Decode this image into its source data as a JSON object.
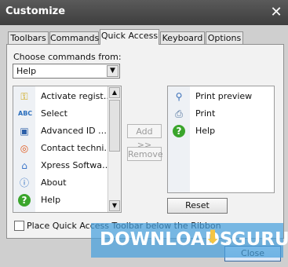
{
  "window": {
    "title": "Customize"
  },
  "tabs": [
    "Toolbars",
    "Commands",
    "Quick Access",
    "Keyboard",
    "Options"
  ],
  "active_tab": "Quick Access",
  "choose": {
    "label": "Choose commands from:",
    "value": "Help"
  },
  "commands": [
    {
      "label": "Activate regist…",
      "icon": "key-icon"
    },
    {
      "label": "Select",
      "icon": "abc-icon"
    },
    {
      "label": "Advanced ID …",
      "icon": "id-card-icon"
    },
    {
      "label": "Contact techni…",
      "icon": "lifebuoy-icon"
    },
    {
      "label": "Xpress Softwa…",
      "icon": "house-icon"
    },
    {
      "label": "About",
      "icon": "info-icon"
    },
    {
      "label": "Help",
      "icon": "help-icon"
    }
  ],
  "buttons": {
    "add": "Add >>",
    "remove": "Remove",
    "reset": "Reset",
    "close": "Close"
  },
  "quick_access": [
    {
      "label": "Print preview",
      "icon": "magnifier-icon"
    },
    {
      "label": "Print",
      "icon": "printer-icon"
    },
    {
      "label": "Help",
      "icon": "help-icon"
    }
  ],
  "checkbox": {
    "label": "Place Quick Access Toolbar below the Ribbon",
    "checked": false
  },
  "watermark": {
    "left": "DOWNLOADS",
    "right": ".GURU"
  }
}
